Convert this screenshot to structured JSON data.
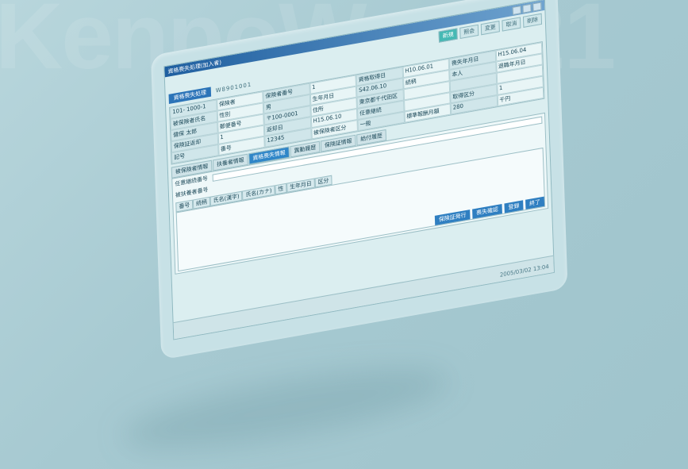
{
  "brand": {
    "watermark": "KenpoWave21"
  },
  "window": {
    "title": "資格喪失処理(加入者)",
    "header_tab": "資格喪失処理",
    "record_code": "W8901001"
  },
  "toolbar": {
    "buttons": [
      "新規",
      "照会",
      "変更",
      "取消",
      "削除"
    ],
    "active_index": 0
  },
  "grid": {
    "cells": [
      "101- 1000-1",
      "保険者",
      "保険者番号",
      "1",
      "資格取得日",
      "H10.06.01",
      "喪失年月日",
      "H15.06.04",
      "被保険者氏名",
      "性別",
      "男",
      "生年月日",
      "S42.06.10",
      "続柄",
      "本人",
      "退職年月日",
      "健保 太郎",
      "郵便番号",
      "〒100-0001",
      "住所",
      "東京都千代田区",
      "",
      "",
      "",
      "保険証返却",
      "1",
      "返却日",
      "H15.06.10",
      "任意継続",
      "",
      "取得区分",
      "1",
      "記号",
      "番号",
      "12345",
      "被保険者区分",
      "一般",
      "標準報酬月額",
      "280",
      "千円"
    ]
  },
  "tabs": {
    "items": [
      "被保険者情報",
      "扶養者情報",
      "資格喪失情報",
      "異動履歴",
      "保険証情報",
      "給付履歴"
    ],
    "selected_index": 2
  },
  "panel": {
    "row_label": "任意継続番号",
    "sub_label": "被扶養者番号",
    "columns": [
      "番号",
      "続柄",
      "氏名(漢字)",
      "氏名(カナ)",
      "性",
      "生年月日",
      "区分"
    ]
  },
  "actions": {
    "buttons": [
      "保険証発行",
      "喪失確認",
      "登録",
      "終了"
    ]
  },
  "status": {
    "datetime": "2005/03/02 13:04"
  }
}
